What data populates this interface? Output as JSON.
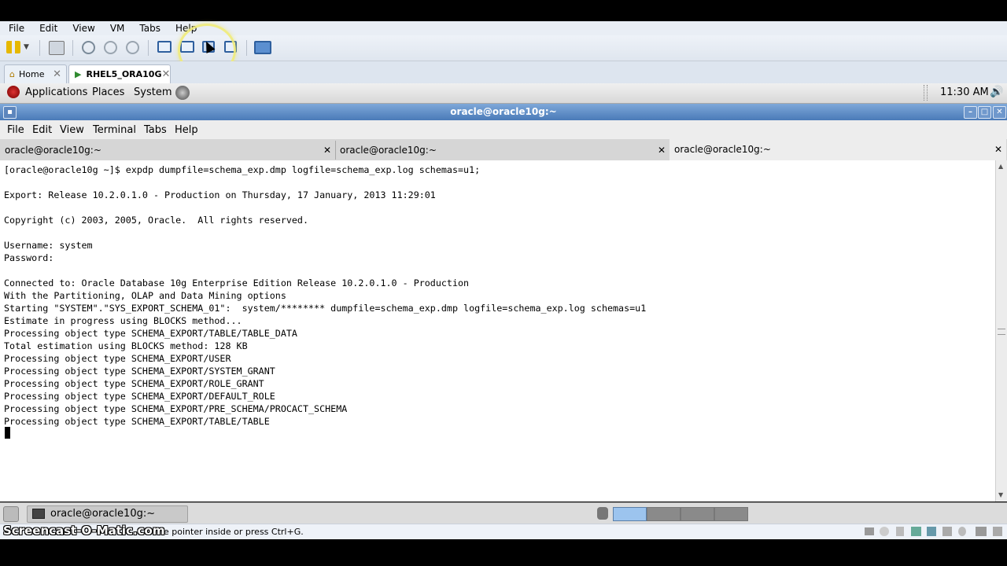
{
  "vmware": {
    "menu": [
      "File",
      "Edit",
      "View",
      "VM",
      "Tabs",
      "Help"
    ],
    "tabs": [
      {
        "label": "Home"
      },
      {
        "label": "RHEL5_ORA10G"
      }
    ]
  },
  "gnome_panel": {
    "menus": [
      "Applications",
      "Places",
      "System"
    ],
    "clock": "11:30 AM"
  },
  "terminal": {
    "title": "oracle@oracle10g:~",
    "menu": [
      "File",
      "Edit",
      "View",
      "Terminal",
      "Tabs",
      "Help"
    ],
    "tabs": [
      "oracle@oracle10g:~",
      "oracle@oracle10g:~",
      "oracle@oracle10g:~"
    ],
    "lines": [
      "[oracle@oracle10g ~]$ expdp dumpfile=schema_exp.dmp logfile=schema_exp.log schemas=u1;",
      "",
      "Export: Release 10.2.0.1.0 - Production on Thursday, 17 January, 2013 11:29:01",
      "",
      "Copyright (c) 2003, 2005, Oracle.  All rights reserved.",
      "",
      "Username: system",
      "Password:",
      "",
      "Connected to: Oracle Database 10g Enterprise Edition Release 10.2.0.1.0 - Production",
      "With the Partitioning, OLAP and Data Mining options",
      "Starting \"SYSTEM\".\"SYS_EXPORT_SCHEMA_01\":  system/******** dumpfile=schema_exp.dmp logfile=schema_exp.log schemas=u1",
      "Estimate in progress using BLOCKS method...",
      "Processing object type SCHEMA_EXPORT/TABLE/TABLE_DATA",
      "Total estimation using BLOCKS method: 128 KB",
      "Processing object type SCHEMA_EXPORT/USER",
      "Processing object type SCHEMA_EXPORT/SYSTEM_GRANT",
      "Processing object type SCHEMA_EXPORT/ROLE_GRANT",
      "Processing object type SCHEMA_EXPORT/DEFAULT_ROLE",
      "Processing object type SCHEMA_EXPORT/PRE_SCHEMA/PROCACT_SCHEMA",
      "Processing object type SCHEMA_EXPORT/TABLE/TABLE"
    ]
  },
  "taskbar": {
    "window_button": "oracle@oracle10g:~"
  },
  "statusbar": {
    "hint": "e pointer inside or press Ctrl+G."
  },
  "watermark": "Screencast-O-Matic.com",
  "colors": {
    "titlebar": "#4a7ab8",
    "active_workspace": "#9cc4ee",
    "highlight_ring": "#f0eb78"
  }
}
